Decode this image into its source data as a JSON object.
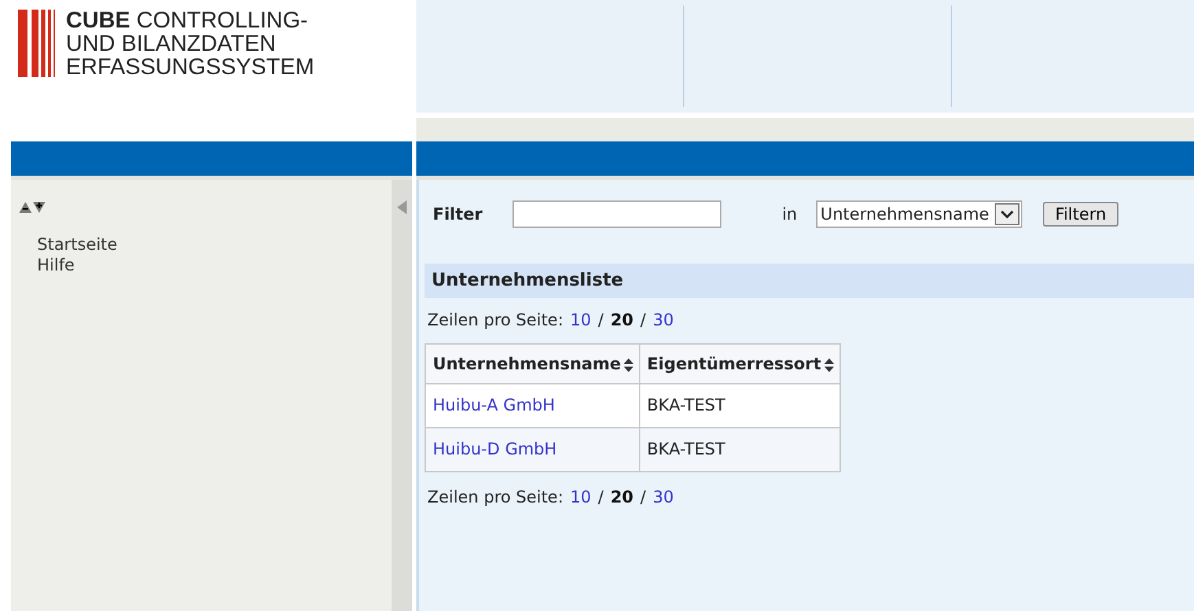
{
  "logo": {
    "lines": [
      "**CUBE** CONTROLLING-",
      "UND BILANZDATEN",
      "ERFASSUNGSSYSTEM"
    ]
  },
  "sidebar": {
    "items": [
      {
        "label": "Startseite"
      },
      {
        "label": "Hilfe"
      }
    ]
  },
  "filter": {
    "label": "Filter",
    "in_label": "in",
    "select_value": "Unternehmensname",
    "button": "Filtern"
  },
  "list": {
    "title": "Unternehmensliste",
    "pager_top": {
      "label": "Zeilen pro Seite:",
      "separators": [
        "/",
        "/"
      ],
      "options": [
        {
          "label": "10",
          "selected": false
        },
        {
          "label": "20",
          "selected": true
        },
        {
          "label": "30",
          "selected": false
        }
      ]
    },
    "columns": [
      "Unternehmensname",
      "Eigentümerressort"
    ],
    "rows": [
      [
        "Huibu-A GmbH",
        "BKA-TEST"
      ],
      [
        "Huibu-D GmbH",
        "BKA-TEST"
      ]
    ],
    "pager_bottom": {
      "label": "Zeilen pro Seite:",
      "separators": [
        "/",
        "/"
      ],
      "options": [
        {
          "label": "10",
          "selected": false
        },
        {
          "label": "20",
          "selected": true
        },
        {
          "label": "30",
          "selected": false
        }
      ]
    }
  }
}
